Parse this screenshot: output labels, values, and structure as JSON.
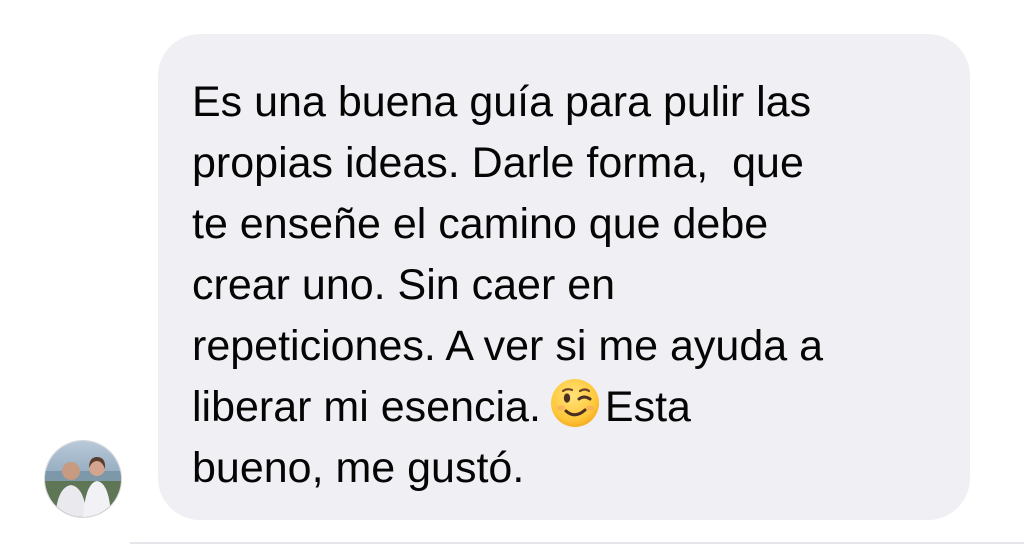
{
  "message": {
    "lines": [
      "Es una buena guía para pulir las",
      "propias ideas. Darle forma,  que",
      "te enseñe el camino que debe",
      "crear uno. Sin caer en",
      "repeticiones. A ver si me ayuda a"
    ],
    "line6_before": "liberar mi esencia.",
    "emoji": "winking-face",
    "line6_after": "Esta",
    "last_line": "bueno, me gustó."
  },
  "colors": {
    "bubble": "#f0f0f4",
    "text": "#050505"
  },
  "icons": {
    "avatar": "profile-photo",
    "emoji": "winking-face-emoji"
  }
}
